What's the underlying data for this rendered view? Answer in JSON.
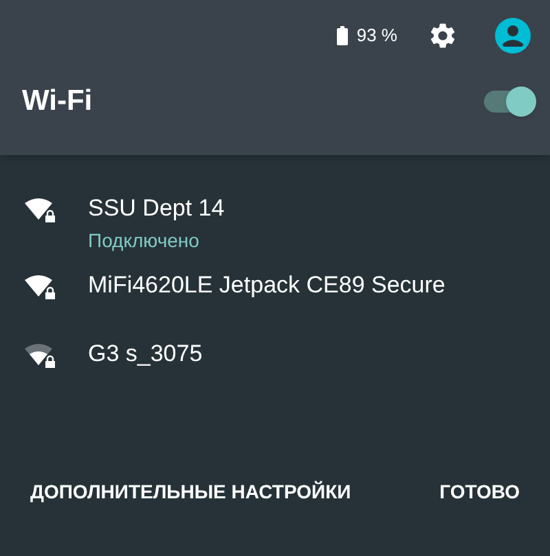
{
  "status_bar": {
    "battery": "93 %"
  },
  "header": {
    "title": "Wi-Fi",
    "wifi_on": true
  },
  "networks": [
    {
      "name": "SSU Dept 14",
      "status": "Подключено",
      "kind": "strong"
    },
    {
      "name": "MiFi4620LE Jetpack CE89 Secure",
      "kind": "strong"
    },
    {
      "name": "G3 s_3075",
      "kind": "weak"
    }
  ],
  "buttons": [
    "ДОПОЛНИТЕЛЬНЫЕ НАСТРОЙКИ",
    "ГОТОВО"
  ]
}
